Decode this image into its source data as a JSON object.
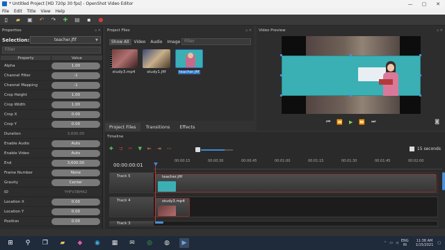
{
  "window": {
    "title": "* Untitled Project [HD 720p 30 fps] - OpenShot Video Editor",
    "min": "—",
    "max": "▢",
    "close": "✕"
  },
  "menu": [
    "File",
    "Edit",
    "Title",
    "View",
    "Help"
  ],
  "toolbar_icons": [
    "new-project-icon",
    "open-project-icon",
    "save-project-icon",
    "undo-icon",
    "redo-icon",
    "import-files-icon",
    "choose-profile-icon",
    "fullscreen-icon",
    "export-video-icon"
  ],
  "properties": {
    "header": "Properties",
    "selection_label": "Selection:",
    "selection_value": "teacher.jfif",
    "filter_placeholder": "Filter",
    "col_property": "Property",
    "col_value": "Value",
    "rows": [
      {
        "name": "Alpha",
        "value": "1.00",
        "readonly": false
      },
      {
        "name": "Channel Filter",
        "value": "-1",
        "readonly": false
      },
      {
        "name": "Channel Mapping",
        "value": "-1",
        "readonly": false
      },
      {
        "name": "Crop Height",
        "value": "1.00",
        "readonly": false
      },
      {
        "name": "Crop Width",
        "value": "1.00",
        "readonly": false
      },
      {
        "name": "Crop X",
        "value": "0.00",
        "readonly": false
      },
      {
        "name": "Crop Y",
        "value": "0.00",
        "readonly": false
      },
      {
        "name": "Duration",
        "value": "3,600.00",
        "readonly": true
      },
      {
        "name": "Enable Audio",
        "value": "Auto",
        "readonly": false
      },
      {
        "name": "Enable Video",
        "value": "Auto",
        "readonly": false
      },
      {
        "name": "End",
        "value": "3,600.00",
        "readonly": false
      },
      {
        "name": "Frame Number",
        "value": "None",
        "readonly": false
      },
      {
        "name": "Gravity",
        "value": "Center",
        "readonly": false
      },
      {
        "name": "ID",
        "value": "YHFV3BHK2",
        "readonly": true
      },
      {
        "name": "Location X",
        "value": "0.00",
        "readonly": false
      },
      {
        "name": "Location Y",
        "value": "0.00",
        "readonly": false
      },
      {
        "name": "Position",
        "value": "0.00",
        "readonly": false
      }
    ]
  },
  "project_files": {
    "header": "Project Files",
    "filters": [
      "Show All",
      "Video",
      "Audio",
      "Image"
    ],
    "search_placeholder": "Filter",
    "files": [
      {
        "name": "study3.mp4",
        "selected": false
      },
      {
        "name": "study1.jfif",
        "selected": false
      },
      {
        "name": "teacher.jfif",
        "selected": true
      }
    ]
  },
  "bottom_tabs": [
    "Project Files",
    "Transitions",
    "Effects"
  ],
  "preview": {
    "header": "Video Preview",
    "controls": [
      "jump-start-icon",
      "rewind-icon",
      "play-icon",
      "fast-forward-icon",
      "jump-end-icon"
    ]
  },
  "timeline": {
    "header": "Timeline",
    "timecode": "00:00:00:01",
    "zoom_label": "15 seconds",
    "ruler": [
      "00:00:15",
      "00:00:30",
      "00:00:45",
      "00:01:00",
      "00:01:15",
      "00:01:30",
      "00:01:45",
      "00:02:00"
    ],
    "tracks": [
      {
        "name": "Track 5",
        "clip": "teacher.jfif"
      },
      {
        "name": "Track 4",
        "clip": "study3.mp4"
      },
      {
        "name": "Track 3",
        "clip": ""
      }
    ]
  },
  "taskbar": {
    "lang1": "ENG",
    "lang2": "IN",
    "time": "11:38 AM",
    "date": "1/15/2021"
  },
  "colors": {
    "accent": "#3b8ad9",
    "clip_border": "#8b2b2b",
    "teal": "#3ab0b5"
  }
}
